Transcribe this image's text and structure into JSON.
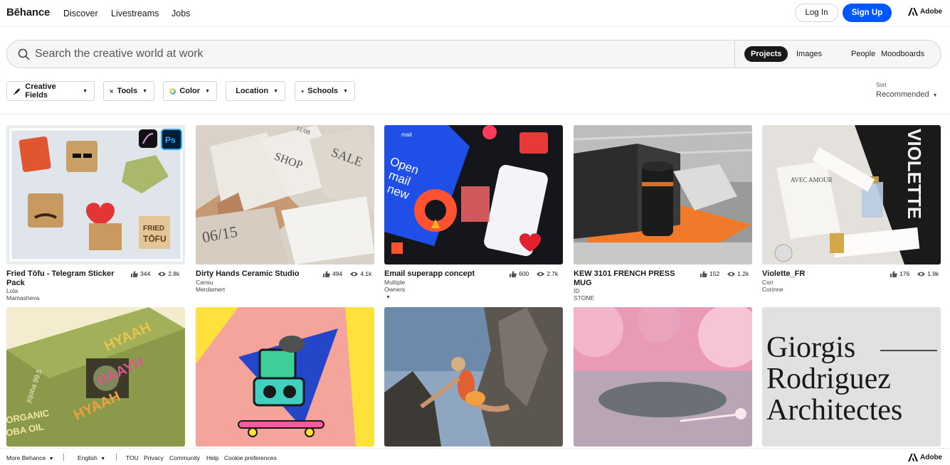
{
  "nav": {
    "logo": "Bēhance",
    "links": [
      "Discover",
      "Livestreams",
      "Jobs"
    ],
    "login": "Log In",
    "signup": "Sign Up",
    "adobe": "Adobe"
  },
  "search": {
    "placeholder": "Search the creative world at work",
    "scopes": [
      "Projects",
      "Images",
      "People",
      "Moodboards"
    ],
    "active_scope": "Projects"
  },
  "filters": [
    "Creative Fields",
    "Tools",
    "Color",
    "Location",
    "Schools"
  ],
  "sort": {
    "label": "Sort",
    "value": "Recommended"
  },
  "projects": [
    {
      "title": "Fried Tōfu - Telegram Sticker Pack",
      "owner": "Lola Mamasheva",
      "likes": "344",
      "views": "2.8k"
    },
    {
      "title": "Dirty Hands Ceramic Studio",
      "owner": "Cansu Merdamert",
      "likes": "494",
      "views": "4.1k"
    },
    {
      "title": "Email superapp concept",
      "owner": "Multiple Owners",
      "likes": "600",
      "views": "2.7k"
    },
    {
      "title": "KEW 3101 FRENCH PRESS MUG",
      "owner": "ID STONE",
      "likes": "152",
      "views": "1.2k"
    },
    {
      "title": "Violette_FR",
      "owner": "Cori Corinne",
      "likes": "176",
      "views": "1.9k"
    }
  ],
  "second_row": {
    "card5_text": [
      "Giorgis",
      "Rodriguez",
      "Architectes"
    ],
    "card1_text": [
      "HYAAH",
      "HAAYH",
      "HYAAH",
      "jojoba 99.5",
      "ORGANIC",
      "OBA OIL"
    ]
  },
  "thumb_text": {
    "card1": [
      "FRIED",
      "TŌFU",
      "Ps"
    ],
    "card2": [
      "SHOP",
      "SALE",
      "06/15",
      "11/08"
    ],
    "card3": [
      "Open",
      "mail",
      "new",
      "mail"
    ],
    "card5": [
      "VIOLETTE",
      "AVEC AMOUR"
    ]
  },
  "footer": {
    "more": "More Behance",
    "language": "English",
    "links": [
      "TOU",
      "Privacy",
      "Community",
      "Help",
      "Cookie preferences"
    ],
    "adobe": "Adobe"
  },
  "colors": {
    "accent": "#0057ff",
    "text": "#191919"
  }
}
